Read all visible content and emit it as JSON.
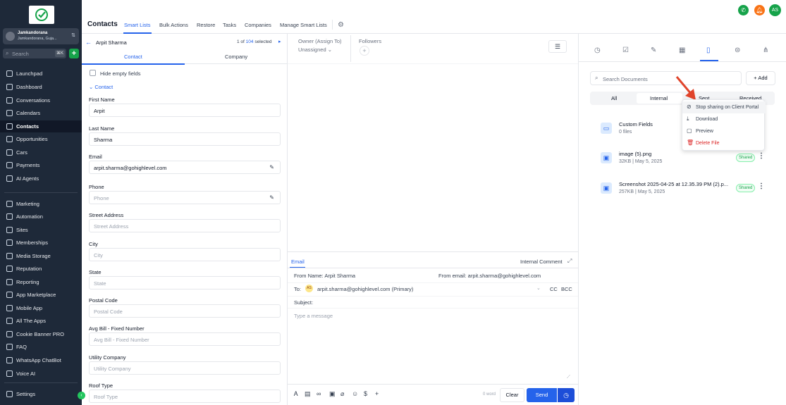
{
  "sidebar": {
    "location_name": "Jamkandorana",
    "location_sub": "Jamkandorana, Guja...",
    "search_placeholder": "Search",
    "search_shortcut": "⌘K",
    "items": [
      {
        "label": "Launchpad"
      },
      {
        "label": "Dashboard"
      },
      {
        "label": "Conversations"
      },
      {
        "label": "Calendars"
      },
      {
        "label": "Contacts"
      },
      {
        "label": "Opportunities"
      },
      {
        "label": "Cars"
      },
      {
        "label": "Payments"
      },
      {
        "label": "AI Agents"
      },
      {
        "label": "Marketing"
      },
      {
        "label": "Automation"
      },
      {
        "label": "Sites"
      },
      {
        "label": "Memberships"
      },
      {
        "label": "Media Storage"
      },
      {
        "label": "Reputation"
      },
      {
        "label": "Reporting"
      },
      {
        "label": "App Marketplace"
      },
      {
        "label": "Mobile App"
      },
      {
        "label": "All The Apps"
      },
      {
        "label": "Cookie Banner PRO"
      },
      {
        "label": "FAQ"
      },
      {
        "label": "WhatsApp ChatBot"
      },
      {
        "label": "Voice AI"
      },
      {
        "label": "Settings"
      }
    ],
    "active_item": "Contacts"
  },
  "header": {
    "title": "Contacts",
    "tabs": [
      "Smart Lists",
      "Bulk Actions",
      "Restore",
      "Tasks",
      "Companies",
      "Manage Smart Lists"
    ],
    "active_tab": "Smart Lists",
    "avatar_initials": "AS"
  },
  "contact": {
    "name": "Arpit Sharma",
    "pager_prefix": "1 of",
    "pager_count": "104",
    "pager_suffix": "selected",
    "tabs": [
      "Contact",
      "Company"
    ],
    "hide_empty_label": "Hide empty fields",
    "section_label": "Contact",
    "fields": [
      {
        "label": "First Name",
        "value": "Arpit",
        "placeholder": ""
      },
      {
        "label": "Last Name",
        "value": "Sharma",
        "placeholder": ""
      },
      {
        "label": "Email",
        "value": "arpit.sharma@gohighlevel.com",
        "placeholder": ""
      },
      {
        "label": "Phone",
        "value": "",
        "placeholder": "Phone"
      },
      {
        "label": "Street Address",
        "value": "",
        "placeholder": "Street Address"
      },
      {
        "label": "City",
        "value": "",
        "placeholder": "City"
      },
      {
        "label": "State",
        "value": "",
        "placeholder": "State"
      },
      {
        "label": "Postal Code",
        "value": "",
        "placeholder": "Postal Code"
      },
      {
        "label": "Avg Bill - Fixed Number",
        "value": "",
        "placeholder": "Avg Bill - Fixed Number"
      },
      {
        "label": "Utility Company",
        "value": "",
        "placeholder": "Utility Company"
      },
      {
        "label": "Roof Type",
        "value": "",
        "placeholder": "Roof Type"
      }
    ]
  },
  "owner": {
    "label": "Owner (Assign To)",
    "value": "Unassigned",
    "followers_label": "Followers"
  },
  "composer": {
    "tab_email": "Email",
    "tab_internal": "Internal Comment",
    "from_name": "From Name:  Arpit Sharma",
    "from_email": "From email:  arpit.sharma@gohighlevel.com",
    "to_label": "To:",
    "to_avatar": "AS",
    "to_value": "arpit.sharma@gohighlevel.com (Primary)",
    "cc": "CC",
    "bcc": "BCC",
    "subject_label": "Subject:",
    "message_placeholder": "Type a message",
    "word_count": "0 word",
    "clear_label": "Clear",
    "send_label": "Send"
  },
  "documents": {
    "search_placeholder": "Search Documents",
    "add_label": "+ Add",
    "tabs": [
      "All",
      "Internal",
      "Sent",
      "Received"
    ],
    "folder": {
      "name": "Custom Fields",
      "meta": "0 files"
    },
    "files": [
      {
        "name": "image (5).png",
        "meta": "32KB | May 5, 2025",
        "badge": "Shared"
      },
      {
        "name": "Screenshot 2025-04-25 at 12.35.39 PM (2).p...",
        "meta": "257KB | May 5, 2025",
        "badge": "Shared"
      }
    ]
  },
  "context_menu": {
    "items": [
      "Stop sharing on Client Portal",
      "Download",
      "Preview",
      "Delete File"
    ]
  },
  "colors": {
    "sidebar_bg": "#1e2939",
    "accent": "#2563eb",
    "shared_green": "#16a34a",
    "danger": "#dc2626",
    "annotation_arrow": "#e0442b"
  }
}
